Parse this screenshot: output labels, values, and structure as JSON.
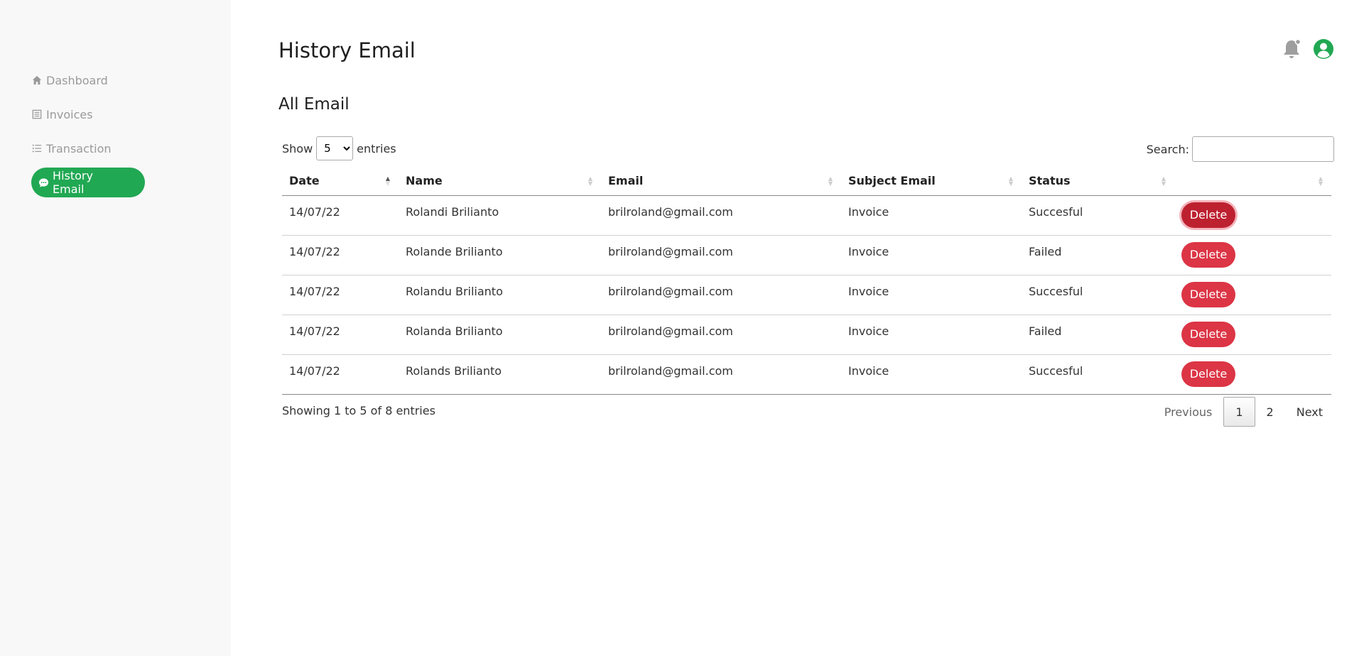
{
  "sidebar": {
    "items": [
      {
        "label": "Dashboard",
        "icon": "home-icon"
      },
      {
        "label": "Invoices",
        "icon": "invoice-icon"
      },
      {
        "label": "Transaction",
        "icon": "list-icon"
      },
      {
        "label": "History Email",
        "icon": "chat-icon",
        "active": true
      }
    ]
  },
  "header": {
    "title": "History Email",
    "icons": [
      "bell-icon",
      "user-avatar-icon"
    ]
  },
  "section": {
    "title": "All Email"
  },
  "controls": {
    "show_label": "Show",
    "entries_value": "5",
    "entries_label": "entries",
    "search_label": "Search:",
    "search_value": ""
  },
  "table": {
    "columns": [
      "Date",
      "Name",
      "Email",
      "Subject Email",
      "Status",
      ""
    ],
    "rows": [
      {
        "date": "14/07/22",
        "name": "Rolandi Brilianto",
        "email": "brilroland@gmail.com",
        "subject": "Invoice",
        "status": "Succesful",
        "action": "Delete"
      },
      {
        "date": "14/07/22",
        "name": "Rolande Brilianto",
        "email": "brilroland@gmail.com",
        "subject": "Invoice",
        "status": "Failed",
        "action": "Delete"
      },
      {
        "date": "14/07/22",
        "name": "Rolandu Brilianto",
        "email": "brilroland@gmail.com",
        "subject": "Invoice",
        "status": "Succesful",
        "action": "Delete"
      },
      {
        "date": "14/07/22",
        "name": "Rolanda Brilianto",
        "email": "brilroland@gmail.com",
        "subject": "Invoice",
        "status": "Failed",
        "action": "Delete"
      },
      {
        "date": "14/07/22",
        "name": "Rolands Brilianto",
        "email": "brilroland@gmail.com",
        "subject": "Invoice",
        "status": "Succesful",
        "action": "Delete"
      }
    ]
  },
  "footer": {
    "info": "Showing 1 to 5 of 8 entries",
    "pagination": {
      "previous": "Previous",
      "pages": [
        "1",
        "2"
      ],
      "next": "Next"
    }
  },
  "colors": {
    "accent": "#21a853",
    "danger": "#dc3545",
    "sidebar_bg": "#f8f8f8"
  }
}
